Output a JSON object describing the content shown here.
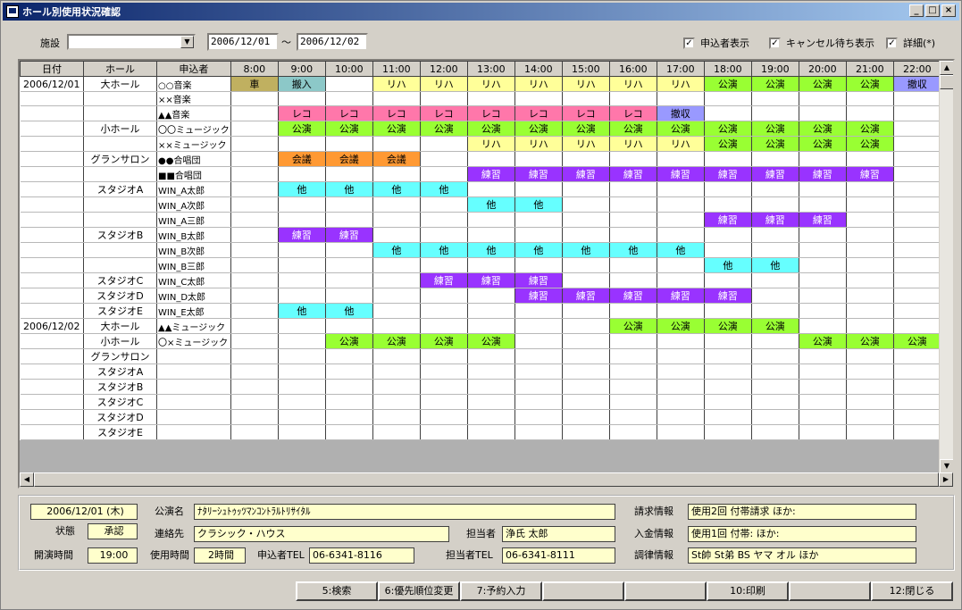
{
  "window": {
    "title": "ホール別使用状況確認",
    "min": "_",
    "max": "□",
    "close": "×"
  },
  "filter": {
    "facility_label": "施設",
    "facility_value": "",
    "date_from": "2006/12/01",
    "tilde": "～",
    "date_to": "2006/12/02",
    "checks": [
      {
        "label": "申込者表示",
        "checked": "✓"
      },
      {
        "label": "キャンセル待ち表示",
        "checked": "✓"
      },
      {
        "label": "詳細(*)",
        "checked": "✓"
      }
    ]
  },
  "grid": {
    "headers": [
      "日付",
      "ホール",
      "申込者",
      "8:00",
      "9:00",
      "10:00",
      "11:00",
      "12:00",
      "13:00",
      "14:00",
      "15:00",
      "16:00",
      "17:00",
      "18:00",
      "19:00",
      "20:00",
      "21:00",
      "22:00"
    ],
    "colors": {
      "車": "#c0b060",
      "搬入": "#8cc8c8",
      "リハ": "#ffff99",
      "公演": "#99ff33",
      "撤収": "#9999ff",
      "レコ": "#ff77aa",
      "会議": "#ff9933",
      "練習": "#9933ff",
      "他": "#66ffff",
      "ミュージック": "#ffffff"
    },
    "rows": [
      {
        "date": "2006/12/01",
        "hall": "大ホール",
        "app": "○○音楽",
        "block": true,
        "cells": [
          "車",
          "搬入",
          "",
          "リハ",
          "リハ",
          "リハ",
          "リハ",
          "リハ",
          "リハ",
          "リハ",
          "公演",
          "公演",
          "公演",
          "公演",
          "撤収"
        ]
      },
      {
        "date": "",
        "hall": "",
        "app": "××音楽",
        "cells": [
          "",
          "",
          "",
          "",
          "",
          "",
          "",
          "",
          "",
          "",
          "",
          "",
          "",
          "",
          ""
        ]
      },
      {
        "date": "",
        "hall": "",
        "app": "▲▲音楽",
        "cells": [
          "",
          "レコ",
          "レコ",
          "レコ",
          "レコ",
          "レコ",
          "レコ",
          "レコ",
          "レコ",
          "撤収",
          "",
          "",
          "",
          "",
          ""
        ]
      },
      {
        "date": "",
        "hall": "小ホール",
        "app": "〇〇ミュージック",
        "block": true,
        "cells": [
          "",
          "公演",
          "公演",
          "公演",
          "公演",
          "公演",
          "公演",
          "公演",
          "公演",
          "公演",
          "公演",
          "公演",
          "公演",
          "公演",
          ""
        ]
      },
      {
        "date": "",
        "hall": "",
        "app": "××ミュージック",
        "cells": [
          "",
          "",
          "",
          "",
          "",
          "リハ",
          "リハ",
          "リハ",
          "リハ",
          "リハ",
          "公演",
          "公演",
          "公演",
          "公演",
          ""
        ]
      },
      {
        "date": "",
        "hall": "グランサロン",
        "app": "●●合唱団",
        "block": true,
        "cells": [
          "",
          "会議",
          "会議",
          "会議",
          "",
          "",
          "",
          "",
          "",
          "",
          "",
          "",
          "",
          "",
          ""
        ]
      },
      {
        "date": "",
        "hall": "",
        "app": "■■合唱団",
        "cells": [
          "",
          "",
          "",
          "",
          "",
          "練習",
          "練習",
          "練習",
          "練習",
          "練習",
          "練習",
          "練習",
          "練習",
          "練習",
          ""
        ]
      },
      {
        "date": "",
        "hall": "スタジオA",
        "app": "WIN_A太郎",
        "block": true,
        "cells": [
          "",
          "他",
          "他",
          "他",
          "他",
          "",
          "",
          "",
          "",
          "",
          "",
          "",
          "",
          "",
          ""
        ]
      },
      {
        "date": "",
        "hall": "",
        "app": "WIN_A次郎",
        "cells": [
          "",
          "",
          "",
          "",
          "",
          "他",
          "他",
          "",
          "",
          "",
          "",
          "",
          "",
          "",
          ""
        ]
      },
      {
        "date": "",
        "hall": "",
        "app": "WIN_A三郎",
        "cells": [
          "",
          "",
          "",
          "",
          "",
          "",
          "",
          "",
          "",
          "",
          "練習",
          "練習",
          "練習",
          "",
          ""
        ]
      },
      {
        "date": "",
        "hall": "スタジオB",
        "app": "WIN_B太郎",
        "block": true,
        "cells": [
          "",
          "練習",
          "練習",
          "",
          "",
          "",
          "",
          "",
          "",
          "",
          "",
          "",
          "",
          "",
          ""
        ]
      },
      {
        "date": "",
        "hall": "",
        "app": "WIN_B次郎",
        "cells": [
          "",
          "",
          "",
          "他",
          "他",
          "他",
          "他",
          "他",
          "他",
          "他",
          "",
          "",
          "",
          "",
          ""
        ]
      },
      {
        "date": "",
        "hall": "",
        "app": "WIN_B三郎",
        "cells": [
          "",
          "",
          "",
          "",
          "",
          "",
          "",
          "",
          "",
          "",
          "他",
          "他",
          "",
          "",
          ""
        ]
      },
      {
        "date": "",
        "hall": "スタジオC",
        "app": "WIN_C太郎",
        "block": true,
        "cells": [
          "",
          "",
          "",
          "",
          "練習",
          "練習",
          "練習",
          "",
          "",
          "",
          "",
          "",
          "",
          "",
          ""
        ]
      },
      {
        "date": "",
        "hall": "スタジオD",
        "app": "WIN_D太郎",
        "block": true,
        "cells": [
          "",
          "",
          "",
          "",
          "",
          "",
          "練習",
          "練習",
          "練習",
          "練習",
          "練習",
          "",
          "",
          "",
          ""
        ]
      },
      {
        "date": "",
        "hall": "スタジオE",
        "app": "WIN_E太郎",
        "block": true,
        "cells": [
          "",
          "他",
          "他",
          "",
          "",
          "",
          "",
          "",
          "",
          "",
          "",
          "",
          "",
          "",
          ""
        ]
      },
      {
        "date": "2006/12/02",
        "hall": "大ホール",
        "app": "▲▲ミュージック",
        "block": true,
        "cells": [
          "",
          "",
          "",
          "",
          "",
          "",
          "",
          "",
          "公演",
          "公演",
          "公演",
          "公演",
          "",
          "",
          ""
        ]
      },
      {
        "date": "",
        "hall": "小ホール",
        "app": "〇×ミュージック",
        "block": true,
        "cells": [
          "",
          "",
          "公演",
          "公演",
          "公演",
          "公演",
          "",
          "",
          "",
          "",
          "",
          "",
          "公演",
          "公演",
          "公演"
        ]
      },
      {
        "date": "",
        "hall": "グランサロン",
        "app": "",
        "block": true,
        "cells": [
          "",
          "",
          "",
          "",
          "",
          "",
          "",
          "",
          "",
          "",
          "",
          "",
          "",
          "",
          ""
        ]
      },
      {
        "date": "",
        "hall": "スタジオA",
        "app": "",
        "block": true,
        "cells": [
          "",
          "",
          "",
          "",
          "",
          "",
          "",
          "",
          "",
          "",
          "",
          "",
          "",
          "",
          ""
        ]
      },
      {
        "date": "",
        "hall": "スタジオB",
        "app": "",
        "block": true,
        "cells": [
          "",
          "",
          "",
          "",
          "",
          "",
          "",
          "",
          "",
          "",
          "",
          "",
          "",
          "",
          ""
        ]
      },
      {
        "date": "",
        "hall": "スタジオC",
        "app": "",
        "block": true,
        "cells": [
          "",
          "",
          "",
          "",
          "",
          "",
          "",
          "",
          "",
          "",
          "",
          "",
          "",
          "",
          ""
        ]
      },
      {
        "date": "",
        "hall": "スタジオD",
        "app": "",
        "block": true,
        "cells": [
          "",
          "",
          "",
          "",
          "",
          "",
          "",
          "",
          "",
          "",
          "",
          "",
          "",
          "",
          ""
        ]
      },
      {
        "date": "",
        "hall": "スタジオE",
        "app": "",
        "block": true,
        "cells": [
          "",
          "",
          "",
          "",
          "",
          "",
          "",
          "",
          "",
          "",
          "",
          "",
          "",
          "",
          ""
        ]
      }
    ]
  },
  "detail": {
    "date": "2006/12/01 (木)",
    "status_label": "状態",
    "status": "承認",
    "open_label": "開演時間",
    "open": "19:00",
    "perf_label": "公演名",
    "perf": "ﾅﾀﾘｰｼｭﾄｩｯﾂﾏﾝｺﾝﾄﾗﾙﾄﾘｻｲﾀﾙ",
    "contact_label": "連絡先",
    "contact": "クラシック・ハウス",
    "usetime_label": "使用時間",
    "usetime": "2時間",
    "apptel_label": "申込者TEL",
    "apptel": "06-6341-8116",
    "staff_label": "担当者",
    "staff": "浄氏 太郎",
    "stafftel_label": "担当者TEL",
    "stafftel": "06-6341-8111",
    "bill_label": "請求情報",
    "bill": "使用2回 付帯請求 ほか:",
    "pay_label": "入金情報",
    "pay": "使用1回 付帯:     ほか:",
    "tune_label": "調律情報",
    "tune": "St帥 St弟 BS ヤマ オル ほか"
  },
  "fkeys": [
    "5:検索",
    "6:優先順位変更",
    "7:予約入力",
    "",
    "",
    "10:印刷",
    "",
    "12:閉じる"
  ]
}
